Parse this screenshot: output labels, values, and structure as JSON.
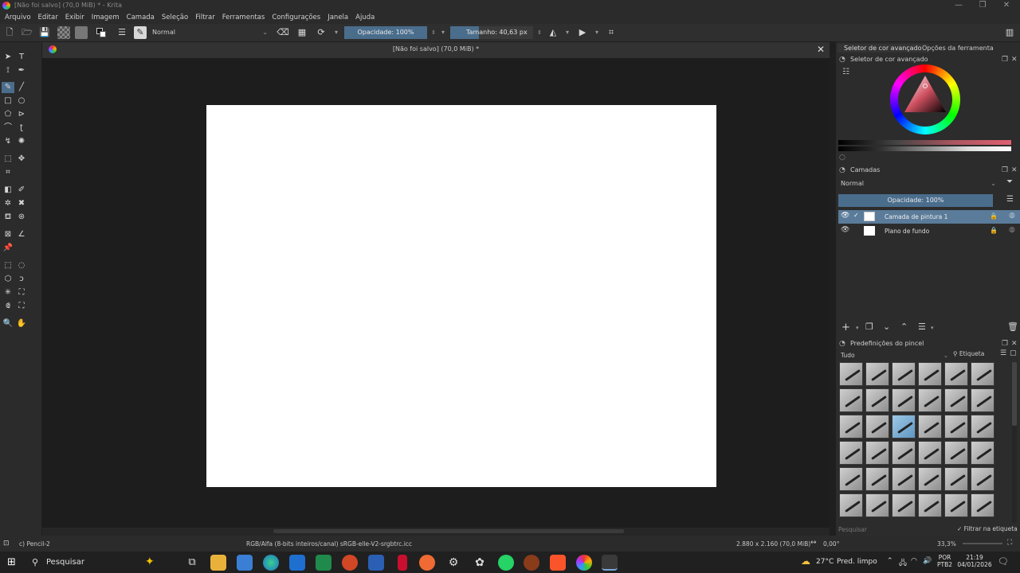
{
  "window": {
    "title": "[Não foi salvo]  (70,0 MiB) * - Krita",
    "controls": [
      "—",
      "❐",
      "✕"
    ]
  },
  "menu": [
    "Arquivo",
    "Editar",
    "Exibir",
    "Imagem",
    "Camada",
    "Seleção",
    "Filtrar",
    "Ferramentas",
    "Configurações",
    "Janela",
    "Ajuda"
  ],
  "toolbar": {
    "blend_mode": "Normal",
    "opacity": "Opacidade: 100%",
    "size": "Tamanho: 40,63 px"
  },
  "document_tab": {
    "title": "[Não foi salvo]  (70,0 MiB) *"
  },
  "right_dock": {
    "tabs": [
      "Seletor de cor avançado",
      "Opções da ferramenta"
    ],
    "color_selector_title": "Seletor de cor avançado",
    "layers": {
      "title": "Camadas",
      "blend_mode": "Normal",
      "opacity": "Opacidade:  100%",
      "items": [
        {
          "name": "Camada de pintura 1",
          "selected": true
        },
        {
          "name": "Plano de fundo",
          "selected": false
        }
      ]
    },
    "brush_presets": {
      "title": "Predefinições do pincel",
      "filter": "Tudo",
      "tag_label": "Etiqueta",
      "search_placeholder": "Pesquisar",
      "filter_by_tag": "Filtrar na etiqueta"
    }
  },
  "statusbar": {
    "brush": "Pencil-2",
    "color_info": "RGB/Alfa (8-bits inteiros/canal)  sRGB-elle-V2-srgbtrc.icc",
    "image_size": "2.880 x 2.160 (70,0 MiB)",
    "rotation": "0,00°",
    "zoom": "33,3%"
  },
  "taskbar": {
    "search": "Pesquisar",
    "weather_temp": "27°C",
    "weather_desc": "Pred. limpo",
    "lang": "POR",
    "layout": "PTB2",
    "time": "21:19",
    "date": "04/01/2026"
  },
  "colors": {
    "accent": "#4a6d8c",
    "selected_layer": "#5a7b99",
    "canvas_bg": "#1d1d1d",
    "paper": "#ffffff"
  }
}
